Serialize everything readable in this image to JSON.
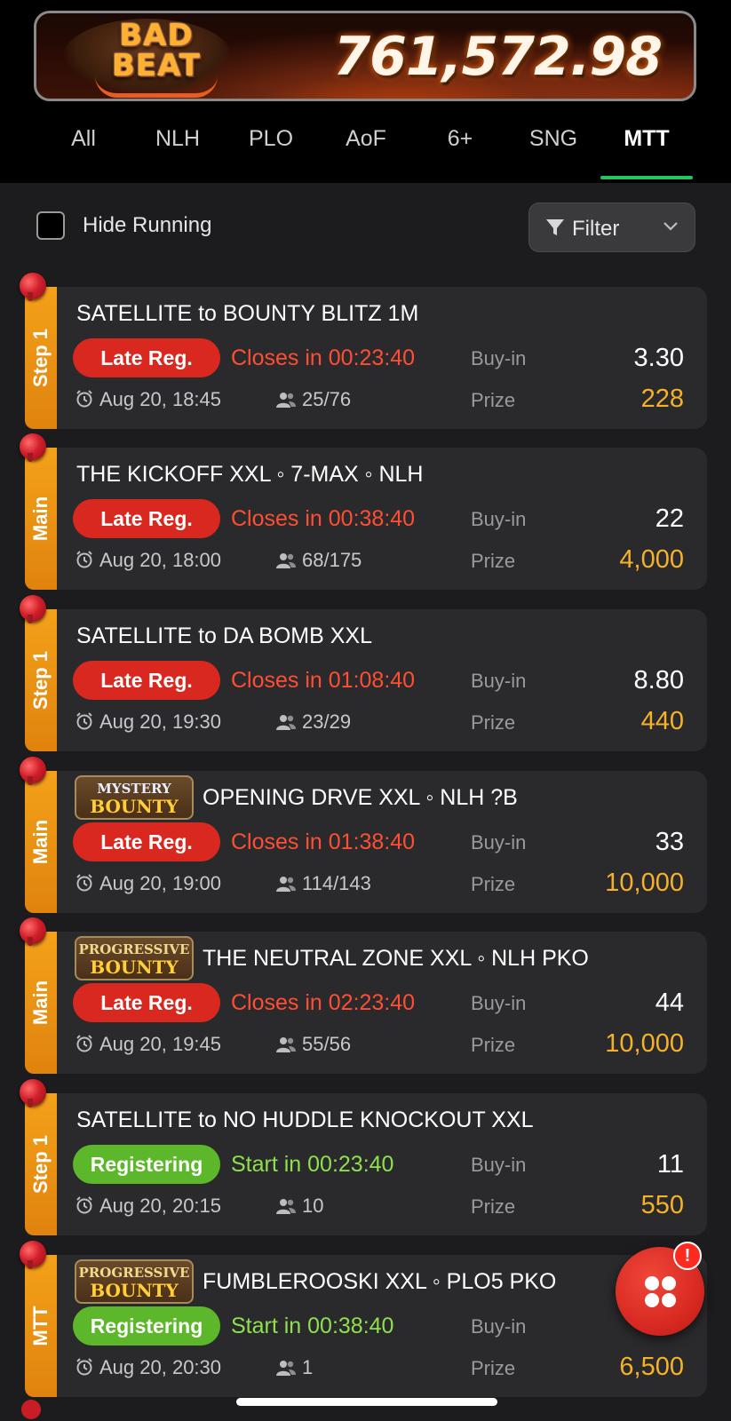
{
  "jackpot": {
    "logo_line1": "BAD",
    "logo_line2": "BEAT",
    "amount": "761,572.98"
  },
  "tabs": [
    {
      "label": "All",
      "active": false
    },
    {
      "label": "NLH",
      "active": false
    },
    {
      "label": "PLO",
      "active": false
    },
    {
      "label": "AoF",
      "active": false
    },
    {
      "label": "6+",
      "active": false
    },
    {
      "label": "SNG",
      "active": false
    },
    {
      "label": "MTT",
      "active": true
    }
  ],
  "toolbar": {
    "hide_running_label": "Hide Running",
    "hide_running_checked": false,
    "filter_label": "Filter"
  },
  "labels": {
    "buyin": "Buy-in",
    "prize": "Prize"
  },
  "tournaments": [
    {
      "tag": "Step 1",
      "badge": null,
      "title": "SATELLITE to BOUNTY BLITZ 1M",
      "status": "Late Reg.",
      "status_type": "late",
      "timer": "Closes in 00:23:40",
      "date": "Aug 20, 18:45",
      "players": "25/76",
      "buyin": "3.30",
      "prize": "228"
    },
    {
      "tag": "Main",
      "badge": null,
      "title": "THE KICKOFF XXL ◦ 7-MAX ◦ NLH",
      "status": "Late Reg.",
      "status_type": "late",
      "timer": "Closes in 00:38:40",
      "date": "Aug 20, 18:00",
      "players": "68/175",
      "buyin": "22",
      "prize": "4,000"
    },
    {
      "tag": "Step 1",
      "badge": null,
      "title": "SATELLITE to DA BOMB XXL",
      "status": "Late Reg.",
      "status_type": "late",
      "timer": "Closes in 01:08:40",
      "date": "Aug 20, 19:30",
      "players": "23/29",
      "buyin": "8.80",
      "prize": "440"
    },
    {
      "tag": "Main",
      "badge": {
        "line1": "MYSTERY",
        "line2": "BOUNTY",
        "kind": "mystery"
      },
      "title": "OPENING DRVE XXL ◦ NLH ?B",
      "status": "Late Reg.",
      "status_type": "late",
      "timer": "Closes in 01:38:40",
      "date": "Aug 20, 19:00",
      "players": "114/143",
      "buyin": "33",
      "prize": "10,000"
    },
    {
      "tag": "Main",
      "badge": {
        "line1": "PROGRESSIVE",
        "line2": "BOUNTY",
        "kind": "progressive"
      },
      "title": "THE NEUTRAL ZONE XXL ◦ NLH PKO",
      "status": "Late Reg.",
      "status_type": "late",
      "timer": "Closes in 02:23:40",
      "date": "Aug 20, 19:45",
      "players": "55/56",
      "buyin": "44",
      "prize": "10,000"
    },
    {
      "tag": "Step 1",
      "badge": null,
      "title": "SATELLITE to NO HUDDLE KNOCKOUT XXL",
      "status": "Registering",
      "status_type": "reg",
      "timer": "Start in 00:23:40",
      "date": "Aug 20, 20:15",
      "players": "10",
      "buyin": "11",
      "prize": "550"
    },
    {
      "tag": "MTT",
      "badge": {
        "line1": "PROGRESSIVE",
        "line2": "BOUNTY",
        "kind": "progressive"
      },
      "title": "FUMBLEROOSKI XXL ◦ PLO5 PKO",
      "status": "Registering",
      "status_type": "reg",
      "timer": "Start in 00:38:40",
      "date": "Aug 20, 20:30",
      "players": "1",
      "buyin": "",
      "prize": "6,500"
    }
  ],
  "fab": {
    "badge_text": "!"
  },
  "colors": {
    "accent_green": "#22c55e",
    "late_red": "#d8281f",
    "reg_green": "#5cb82a",
    "prize_gold": "#f6b12a",
    "tag_orange": "#f4a11a"
  }
}
